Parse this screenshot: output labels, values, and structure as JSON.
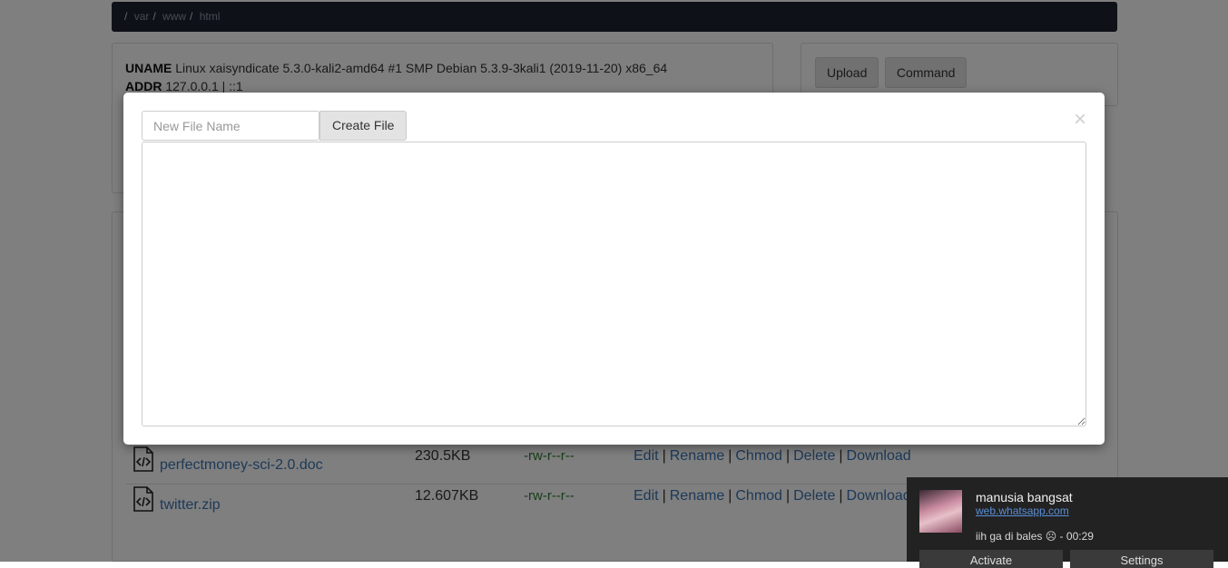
{
  "breadcrumb": {
    "root": "/",
    "segments": [
      "var",
      "www",
      "html"
    ],
    "separator": "/"
  },
  "system_info": {
    "uname_label": "UNAME",
    "uname_value": "Linux xaisyndicate 5.3.0-kali2-amd64 #1 SMP Debian 5.3.9-3kali1 (2019-11-20) x86_64",
    "addr_label": "ADDR",
    "addr_value": "127.0.0.1 | ::1"
  },
  "toolbar": {
    "upload_label": "Upload",
    "command_label": "Command"
  },
  "files": [
    {
      "name": "perfectmoney-sci-2.0.doc",
      "size": "230.5KB",
      "perms": "-rw-r--r--"
    },
    {
      "name": "twitter.zip",
      "size": "12.607KB",
      "perms": "-rw-r--r--"
    }
  ],
  "file_actions": [
    "Edit",
    "Rename",
    "Chmod",
    "Delete",
    "Download"
  ],
  "modal": {
    "filename_placeholder": "New File Name",
    "create_label": "Create File",
    "close_glyph": "×"
  },
  "notification": {
    "title": "manusia bangsat",
    "source": "web.whatsapp.com",
    "message": "iih ga di bales ☹ - 00:29",
    "activate_label": "Activate",
    "settings_label": "Settings"
  },
  "colors": {
    "breadcrumb_bg": "#1e2230",
    "link": "#3a73b0",
    "perm": "#2e7d32",
    "notification_bg": "#222222"
  }
}
